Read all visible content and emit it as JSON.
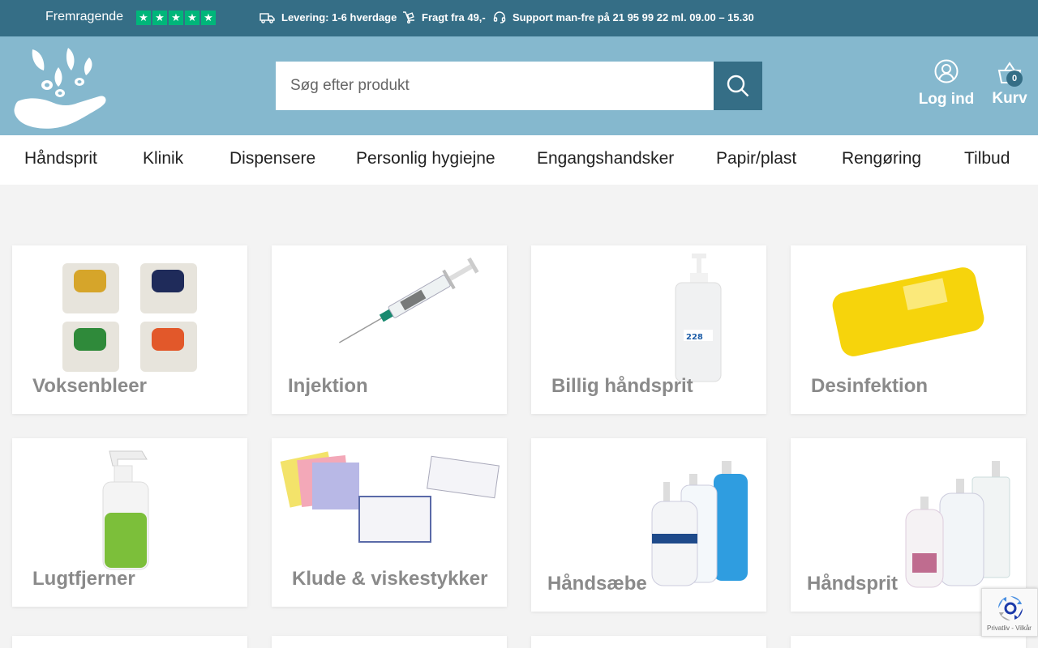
{
  "topbar": {
    "rating_text": "Fremragende",
    "stars": [
      "★",
      "★",
      "★",
      "★",
      "★"
    ],
    "usp_delivery": "Levering: 1-6 hverdage",
    "usp_freight": "Fragt fra 49,-",
    "usp_support": "Support man-fre på 21 95 99 22 ml. 09.00 – 15.30"
  },
  "header": {
    "search_placeholder": "Søg efter produkt",
    "login_label": "Log ind",
    "cart_label": "Kurv",
    "cart_count": "0"
  },
  "nav": {
    "items": [
      "Håndsprit",
      "Klinik",
      "Dispensere",
      "Personlig hygiejne",
      "Engangshandsker",
      "Papir/plast",
      "Rengøring",
      "Tilbud"
    ]
  },
  "categories": [
    {
      "label": "Voksenbleer"
    },
    {
      "label": "Injektion"
    },
    {
      "label": "Billig håndsprit"
    },
    {
      "label": "Desinfektion"
    },
    {
      "label": "Lugtfjerner"
    },
    {
      "label": "Klude & viskestykker"
    },
    {
      "label": "Håndsæbe"
    },
    {
      "label": "Håndsprit"
    }
  ],
  "recaptcha": {
    "terms": "Privatliv - Vilkår"
  },
  "colors": {
    "topbar": "#356e86",
    "header": "#85b8ce",
    "trustpilot": "#00b67a"
  }
}
